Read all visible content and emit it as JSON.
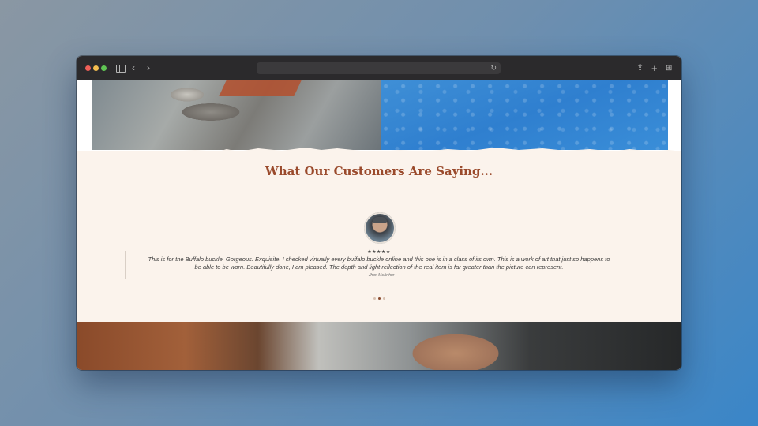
{
  "browser": {
    "url": "",
    "icons": [
      "sidebar-icon",
      "back-icon",
      "forward-icon",
      "reload-icon",
      "share-icon",
      "new-tab-icon",
      "tabs-overview-icon"
    ]
  },
  "testimonials": {
    "title": "What Our Customers Are Saying...",
    "rating": "★★★★★",
    "quote_line1": "This is for the Buffalo buckle. Gorgeous. Exquisite. I checked virtually every buffalo buckle online and this one is in a class of its own. This is a work of art that just so happens to",
    "quote_line2": "be able to be worn. Beautifully done, I am pleased. The depth and light reflection of the real item is far greater than the picture can represent.",
    "author": "— Jhon McArthur",
    "pager_count": 3,
    "pager_active": 2
  },
  "colors": {
    "title": "#9a4a2c",
    "section_bg": "#fbf3ec",
    "pager_active": "#8a4a2e"
  }
}
